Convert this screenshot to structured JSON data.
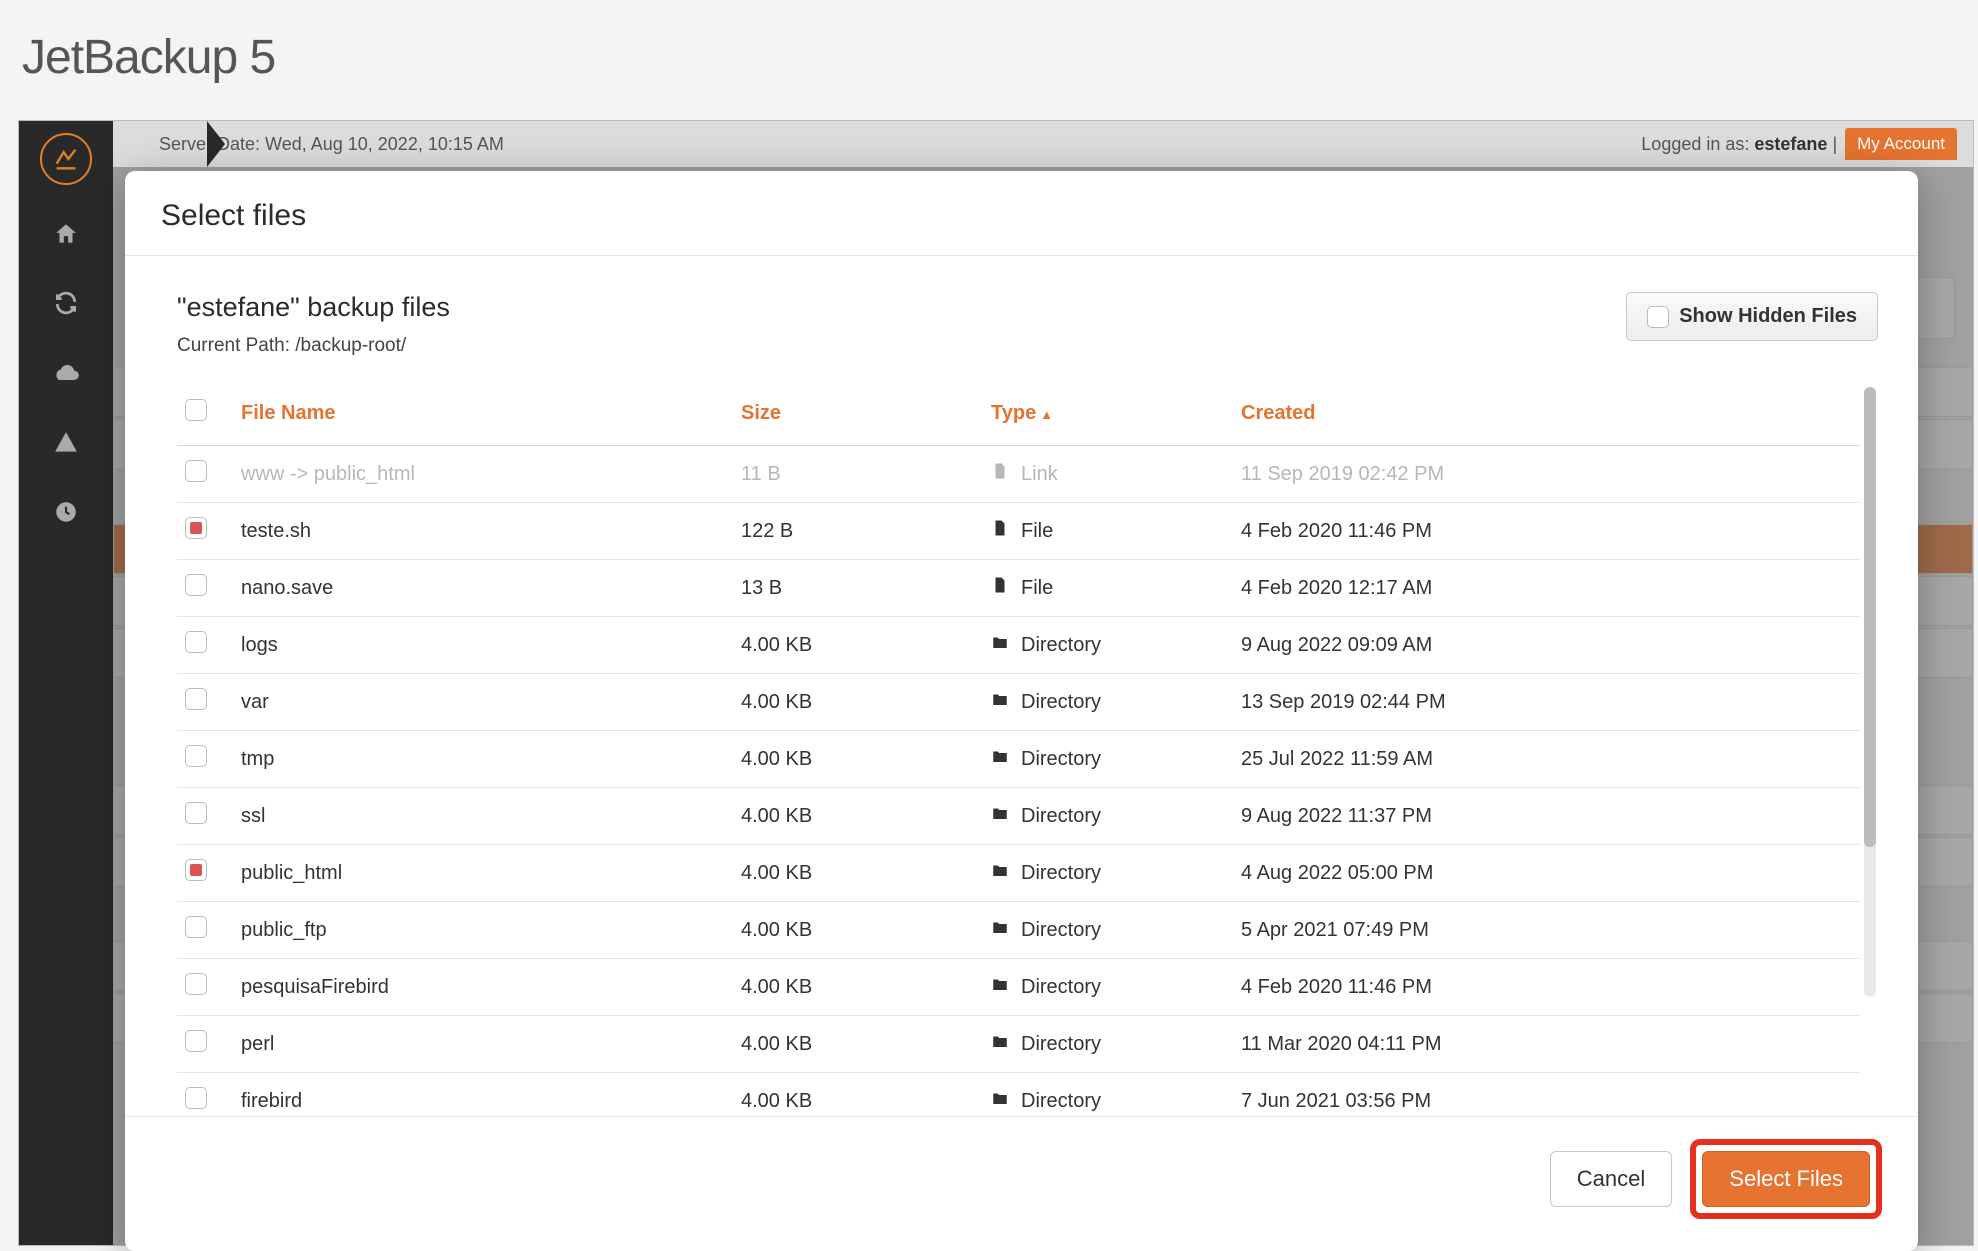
{
  "app": {
    "title": "JetBackup 5"
  },
  "topbar": {
    "server_date_label": "Server Date: Wed, Aug 10, 2022, 10:15 AM",
    "logged_in_prefix": "Logged in as: ",
    "username": "estefane",
    "my_account": "My Account"
  },
  "modal": {
    "title": "Select files",
    "subtitle": "\"estefane\" backup files",
    "path_label": "Current Path: /backup-root/",
    "show_hidden": "Show Hidden Files",
    "columns": {
      "name": "File Name",
      "size": "Size",
      "type": "Type",
      "created": "Created"
    },
    "types": {
      "link": "Link",
      "file": "File",
      "directory": "Directory"
    },
    "rows": [
      {
        "name": "www -> public_html",
        "size": "11 B",
        "type": "link",
        "created": "11 Sep 2019 02:42 PM",
        "disabled": true,
        "checked": "none"
      },
      {
        "name": "teste.sh",
        "size": "122 B",
        "type": "file",
        "created": "4 Feb 2020 11:46 PM",
        "checked": "partial"
      },
      {
        "name": "nano.save",
        "size": "13 B",
        "type": "file",
        "created": "4 Feb 2020 12:17 AM",
        "checked": "none"
      },
      {
        "name": "logs",
        "size": "4.00 KB",
        "type": "directory",
        "created": "9 Aug 2022 09:09 AM",
        "checked": "none"
      },
      {
        "name": "var",
        "size": "4.00 KB",
        "type": "directory",
        "created": "13 Sep 2019 02:44 PM",
        "checked": "none"
      },
      {
        "name": "tmp",
        "size": "4.00 KB",
        "type": "directory",
        "created": "25 Jul 2022 11:59 AM",
        "checked": "none"
      },
      {
        "name": "ssl",
        "size": "4.00 KB",
        "type": "directory",
        "created": "9 Aug 2022 11:37 PM",
        "checked": "none"
      },
      {
        "name": "public_html",
        "size": "4.00 KB",
        "type": "directory",
        "created": "4 Aug 2022 05:00 PM",
        "checked": "partial"
      },
      {
        "name": "public_ftp",
        "size": "4.00 KB",
        "type": "directory",
        "created": "5 Apr 2021 07:49 PM",
        "checked": "none"
      },
      {
        "name": "pesquisaFirebird",
        "size": "4.00 KB",
        "type": "directory",
        "created": "4 Feb 2020 11:46 PM",
        "checked": "none"
      },
      {
        "name": "perl",
        "size": "4.00 KB",
        "type": "directory",
        "created": "11 Mar 2020 04:11 PM",
        "checked": "none"
      },
      {
        "name": "firebird",
        "size": "4.00 KB",
        "type": "directory",
        "created": "7 Jun 2021 03:56 PM",
        "checked": "none"
      }
    ],
    "buttons": {
      "cancel": "Cancel",
      "select": "Select Files"
    }
  }
}
